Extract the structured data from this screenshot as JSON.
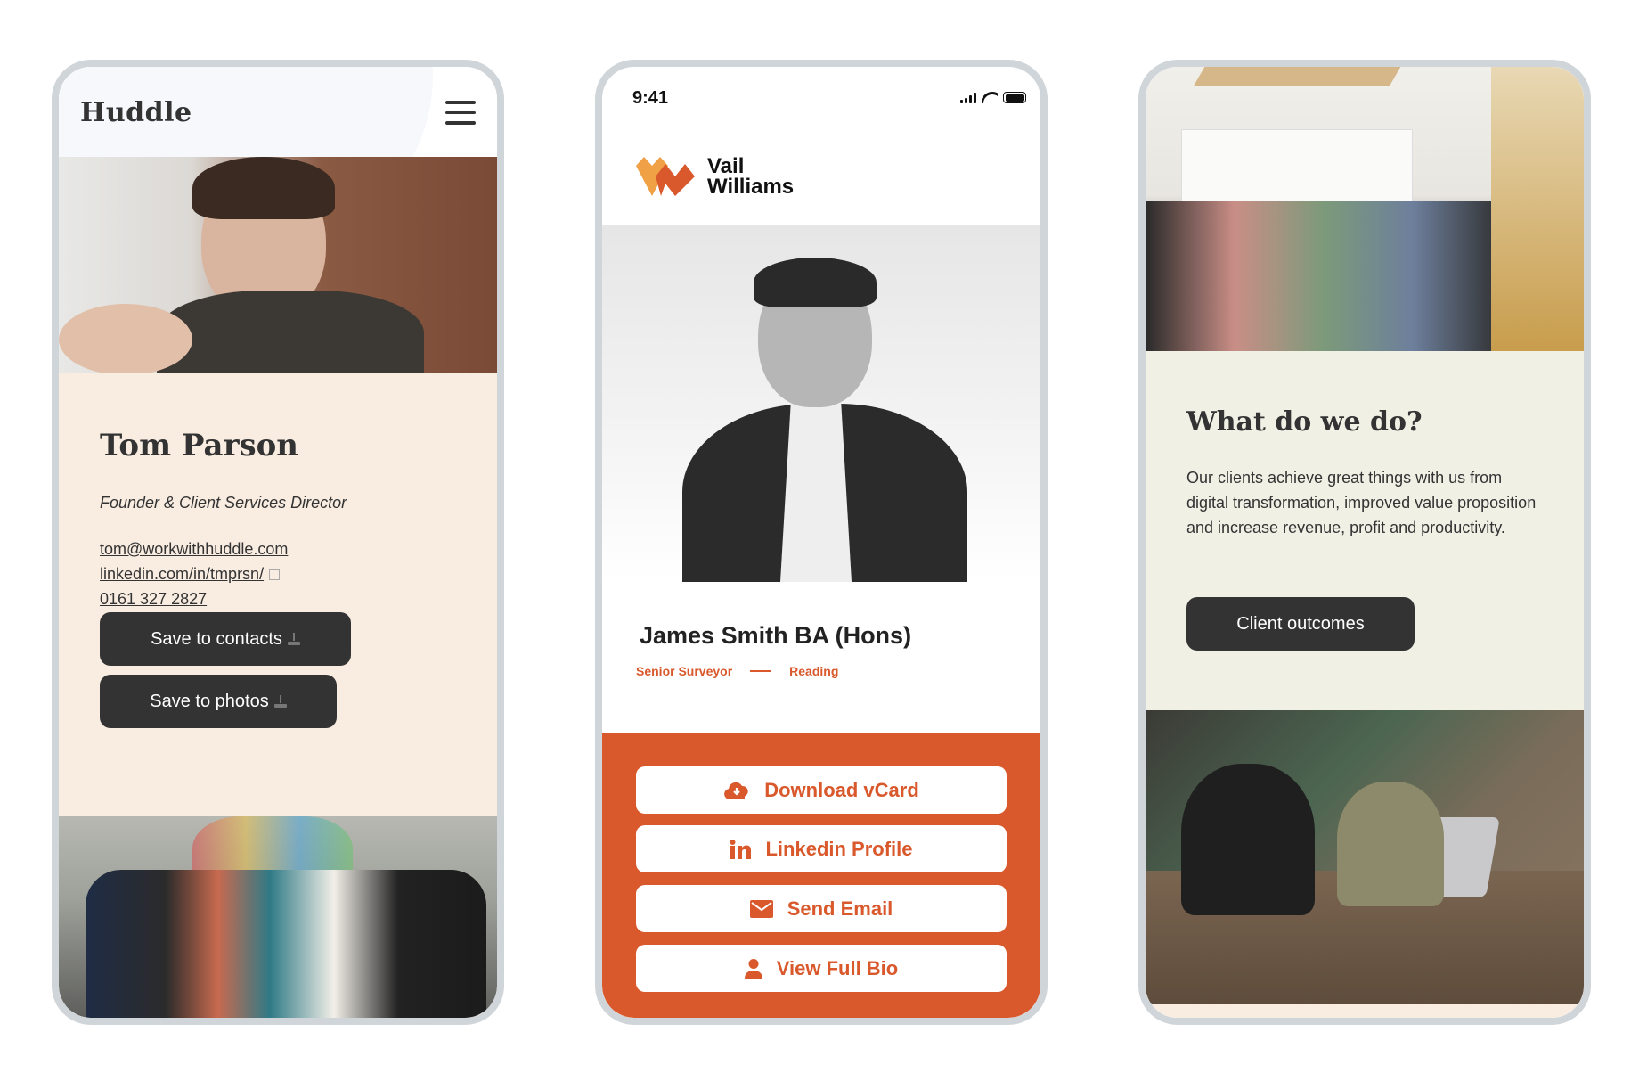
{
  "phones": {
    "huddle": {
      "brand": "Huddle",
      "menu_icon": "hamburger-menu-icon",
      "hero_photo": "portrait of man with glasses in front of brick wall",
      "name": "Tom Parson",
      "role": "Founder & Client Services Director",
      "email": "tom@workwithhuddle.com",
      "linkedin": "linkedin.com/in/tmprsn/",
      "phone": "0161 327 2827",
      "save_contacts_label": "Save to contacts",
      "save_photos_label": "Save to photos",
      "team_photo": "team group photo in front of mural",
      "colors": {
        "bio_bg": "#f9ede2",
        "button_bg": "#333333"
      }
    },
    "vail_williams": {
      "status_time": "9:41",
      "logo_line1": "Vail",
      "logo_line2": "Williams",
      "portrait": "black and white portrait of man in suit",
      "name": "James Smith BA (Hons)",
      "title": "Senior Surveyor",
      "location": "Reading",
      "buttons": [
        {
          "label": "Download vCard",
          "icon": "cloud-download-icon"
        },
        {
          "label": "Linkedin Profile",
          "icon": "linkedin-icon"
        },
        {
          "label": "Send Email",
          "icon": "envelope-icon"
        },
        {
          "label": "View Full Bio",
          "icon": "user-icon"
        }
      ],
      "colors": {
        "accent": "#d9592c",
        "logo_light": "#f0a045",
        "logo_dark": "#d9592c"
      }
    },
    "what_we_do": {
      "meeting_photo": "team meeting with presenter at whiteboard",
      "heading": "What do we do?",
      "paragraph": "Our clients achieve great things with us from digital transformation, improved value proposition and increase revenue, profit and productivity.",
      "cta_label": "Client outcomes",
      "work_photo": "two people working at laptop on wooden table",
      "colors": {
        "panel_bg": "#f0f0e5",
        "button_bg": "#333333"
      }
    }
  }
}
